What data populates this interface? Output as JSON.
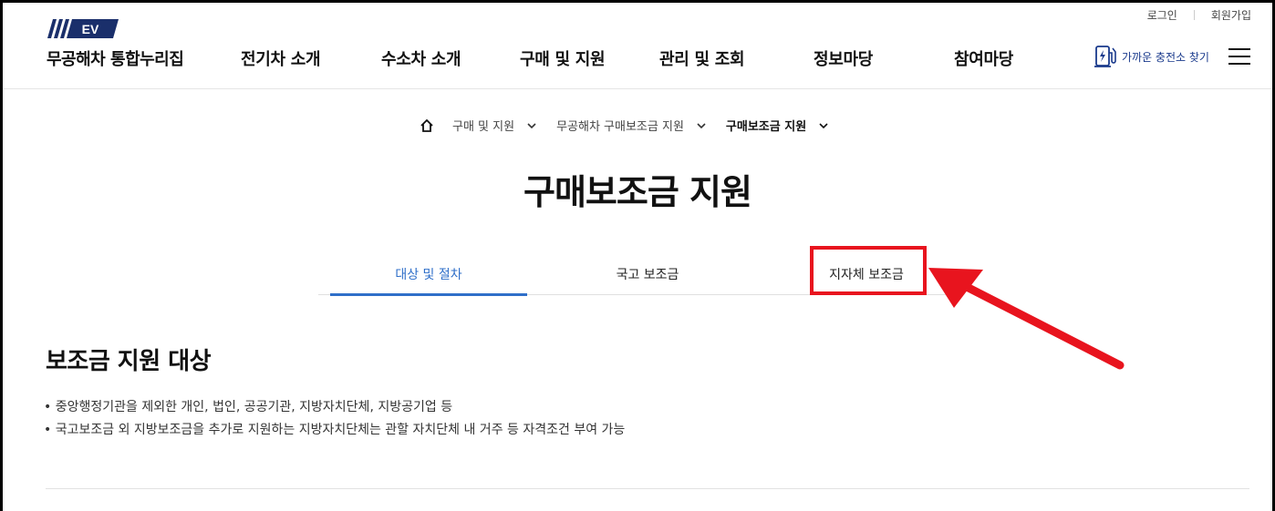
{
  "header": {
    "logo_mark_text": "EV",
    "logo_text": "무공해차 통합누리집",
    "util_links": [
      "로그인",
      "회원가입"
    ],
    "nav": [
      "전기차 소개",
      "수소차 소개",
      "구매 및 지원",
      "관리 및 조회",
      "정보마당",
      "참여마당"
    ],
    "charger_link": "가까운 충전소 찾기"
  },
  "breadcrumb": [
    "구매 및 지원",
    "무공해차 구매보조금 지원",
    "구매보조금 지원"
  ],
  "page_title": "구매보조금 지원",
  "tabs": {
    "items": [
      "대상 및 절차",
      "국고 보조금",
      "지자체 보조금"
    ],
    "active": "대상 및 절차"
  },
  "section": {
    "title": "보조금 지원 대상",
    "bullets": [
      "중앙행정기관을 제외한 개인, 법인, 공공기관, 지방자치단체, 지방공기업 등",
      "국고보조금 외 지방보조금을 추가로 지원하는 지방자치단체는 관할 자치단체 내 거주 등 자격조건 부여 가능"
    ]
  },
  "colors": {
    "accent": "#2f6fc9",
    "annotation": "#e8141e",
    "brand_dark": "#1a2f6b"
  }
}
